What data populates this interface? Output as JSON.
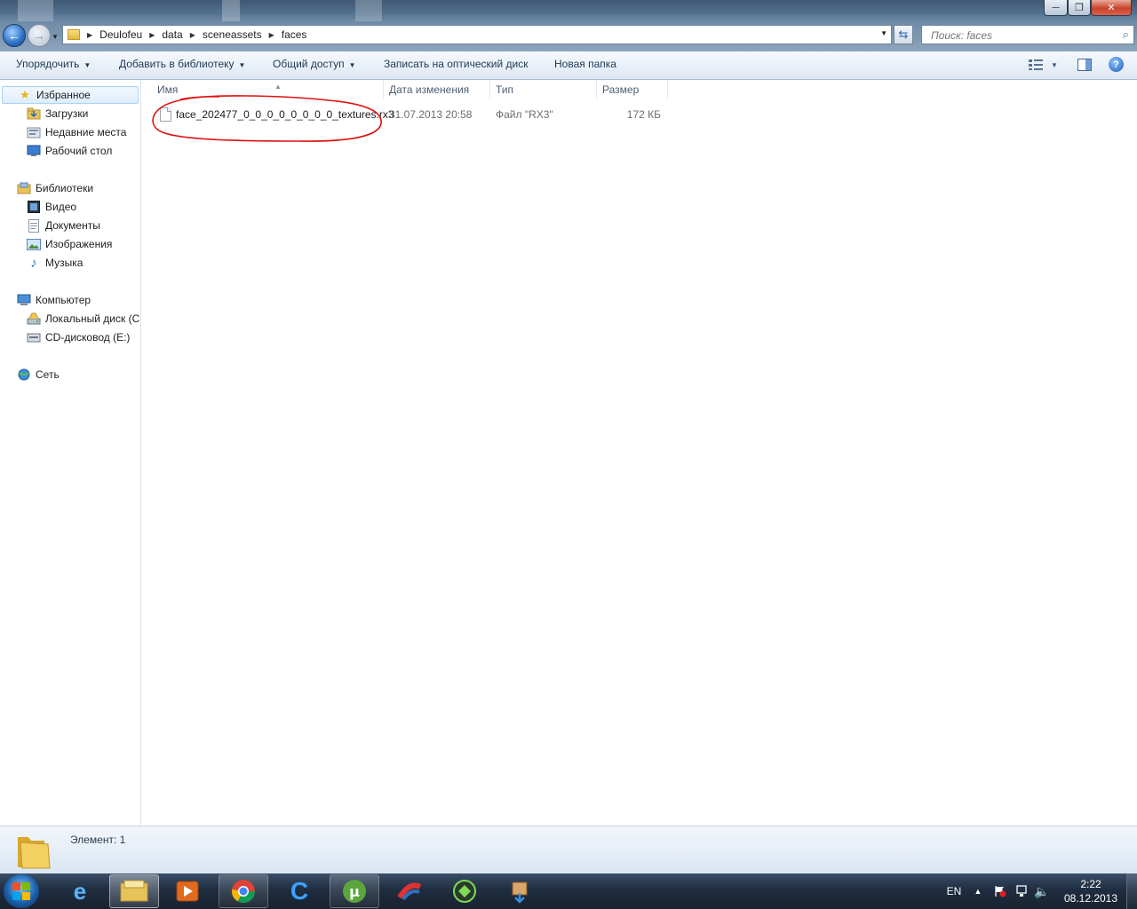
{
  "window": {
    "minimize_label": "─",
    "maximize_label": "❐",
    "close_label": "✕"
  },
  "address": {
    "crumbs": [
      "Deulofeu",
      "data",
      "sceneassets",
      "faces"
    ]
  },
  "search": {
    "placeholder": "Поиск: faces"
  },
  "toolbar": {
    "organize": "Упорядочить",
    "add_to_library": "Добавить в библиотеку",
    "share": "Общий доступ",
    "burn": "Записать на оптический диск",
    "new_folder": "Новая папка"
  },
  "sidebar": {
    "favorites": {
      "label": "Избранное",
      "items": [
        "Загрузки",
        "Недавние места",
        "Рабочий стол"
      ]
    },
    "libraries": {
      "label": "Библиотеки",
      "items": [
        "Видео",
        "Документы",
        "Изображения",
        "Музыка"
      ]
    },
    "computer": {
      "label": "Компьютер",
      "items": [
        "Локальный диск (C",
        "CD-дисковод (E:)"
      ]
    },
    "network": {
      "label": "Сеть"
    }
  },
  "columns": {
    "name": "Имя",
    "modified": "Дата изменения",
    "type": "Тип",
    "size": "Размер"
  },
  "files": [
    {
      "name": "face_202477_0_0_0_0_0_0_0_0_textures.rx3",
      "modified": "31.07.2013 20:58",
      "type": "Файл \"RX3\"",
      "size": "172 КБ"
    }
  ],
  "status": {
    "items_count": "Элемент: 1"
  },
  "taskbar": {
    "language": "EN",
    "time": "2:22",
    "date": "08.12.2013"
  },
  "colors": {
    "annotation_circle": "#e01010",
    "selection": "#ddeefc"
  }
}
